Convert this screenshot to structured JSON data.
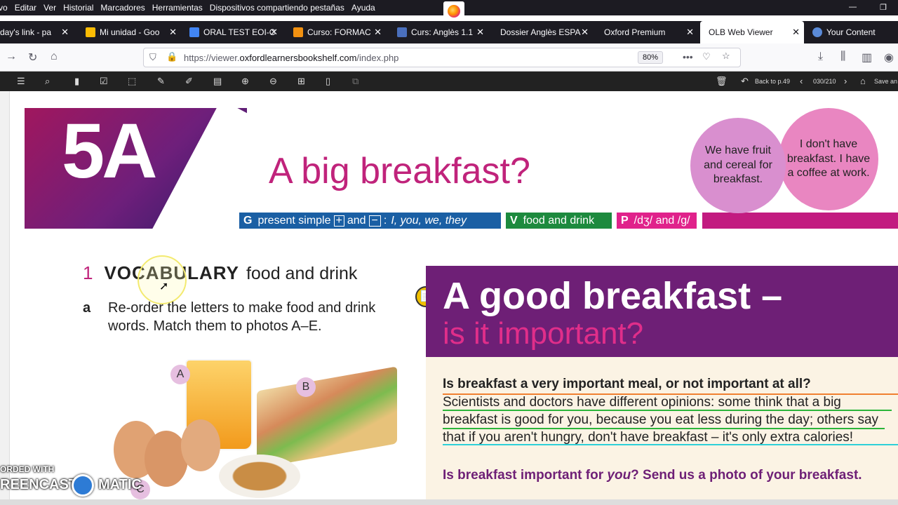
{
  "menu": [
    "vo",
    "Editar",
    "Ver",
    "Historial",
    "Marcadores",
    "Herramientas",
    "Dispositivos compartiendo pestañas",
    "Ayuda"
  ],
  "tabs": [
    {
      "label": "day's link - pa",
      "color": "#999"
    },
    {
      "label": "Mi unidad - Goo",
      "color": "#fbbc04"
    },
    {
      "label": "ORAL TEST EOI-C",
      "color": "#4285f4"
    },
    {
      "label": "Curso: FORMAC",
      "color": "#f29111"
    },
    {
      "label": "Curs: Anglès 1.1",
      "color": "#4a6fbd"
    },
    {
      "label": "Dossier Anglès ESPA",
      "color": ""
    },
    {
      "label": "Oxford Premium",
      "color": ""
    },
    {
      "label": "OLB Web Viewer",
      "color": ""
    },
    {
      "label": "Your Content",
      "color": "#5b8bd8"
    }
  ],
  "url": {
    "prefix": "https://viewer.",
    "domain": "oxfordlearnersbookshelf.com",
    "path": "/index.php"
  },
  "zoom": "80%",
  "viewer": {
    "back": "Back to p.49",
    "page": "030/210",
    "save": "Save an"
  },
  "banner": {
    "lesson": "5A",
    "title": "A big breakfast?"
  },
  "bubbles": {
    "b1": "We have fruit and cereal for breakfast.",
    "b2": "I don't have breakfast. I have a coffee at work."
  },
  "pills": {
    "g_letter": "G",
    "g_text": "present simple",
    "and1": "and",
    "colon": ":",
    "pron": "I, you, we, they",
    "v_letter": "V",
    "v_text": "food and drink",
    "p_letter": "P",
    "p_text": "/dʒ/ and /g/"
  },
  "section1": {
    "num": "1",
    "word": "VOCABULARY",
    "sub": "food and drink"
  },
  "exercise": {
    "letter": "a",
    "text": "Re-order the letters to make food and drink words. Match them to photos A–E."
  },
  "photo_labels": {
    "a": "A",
    "b": "B",
    "c": "C"
  },
  "article": {
    "h1": "A good breakfast –",
    "h2": "is it important?",
    "q1": "Is breakfast a very important meal, or not important at all?",
    "body": "Scientists and doctors have different opinions: some think that a big breakfast is good for you, because you eat less during the day; others say that if you aren't hungry, don't have breakfast – it's only extra calories!",
    "q2a": "Is breakfast important for ",
    "q2b": "you",
    "q2c": "? Send us a photo of your breakfast."
  },
  "watermark": {
    "line1": "ORDED WITH",
    "line2": "REENCAST",
    "line3": "MATIC"
  }
}
